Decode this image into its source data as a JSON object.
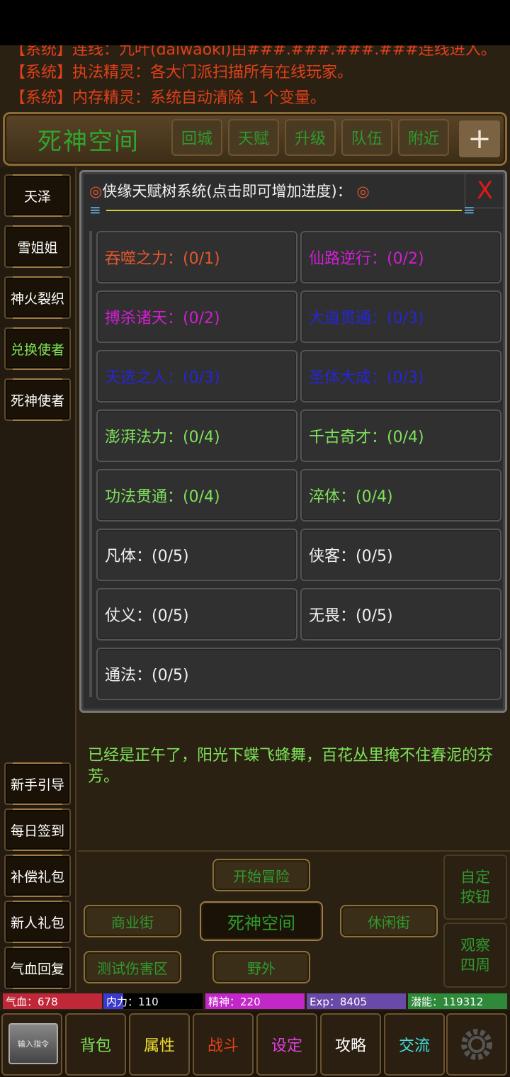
{
  "system_messages": [
    "【系统】连线：九叶(daiwaoki)由###.###.###.###连线进入。",
    "【系统】执法精灵：各大门派扫描所有在线玩家。",
    "【系统】内存精灵：系统自动清除 1 个变量。"
  ],
  "location": {
    "title": "死神空间",
    "buttons": [
      "回城",
      "天赋",
      "升级",
      "队伍",
      "附近"
    ],
    "plus": "+"
  },
  "sidebar_top": [
    "天泽",
    "雪姐姐",
    "神火裂织",
    "兑换使者",
    "死神使者"
  ],
  "sidebar_top_colors": [
    "#ffffff",
    "#ffffff",
    "#ffffff",
    "#7ee25a",
    "#ffffff"
  ],
  "sidebar_bottom": [
    "新手引导",
    "每日签到",
    "补偿礼包",
    "新人礼包",
    "气血回复"
  ],
  "modal": {
    "title_prefix": "◎",
    "title": "侠缘天赋树系统(点击即可增加进度)：",
    "title_suffix": "◎",
    "close": "X",
    "talents": [
      {
        "label": "吞噬之力：(0/1)",
        "color": "#e4572e"
      },
      {
        "label": "仙路逆行：(0/2)",
        "color": "#d21ed2"
      },
      {
        "label": "搏杀诸天：(0/2)",
        "color": "#d21ed2"
      },
      {
        "label": "大道贯通：(0/3)",
        "color": "#2626d6"
      },
      {
        "label": "天选之人：(0/3)",
        "color": "#2626d6"
      },
      {
        "label": "圣体大成：(0/3)",
        "color": "#2626d6"
      },
      {
        "label": "澎湃法力：(0/4)",
        "color": "#7ee25a"
      },
      {
        "label": "千古奇才：(0/4)",
        "color": "#7ee25a"
      },
      {
        "label": "功法贯通：(0/4)",
        "color": "#7ee25a"
      },
      {
        "label": "淬体：(0/4)",
        "color": "#7ee25a"
      },
      {
        "label": "凡体：(0/5)",
        "color": "#f2f2f2"
      },
      {
        "label": "侠客：(0/5)",
        "color": "#f2f2f2"
      },
      {
        "label": "仗义：(0/5)",
        "color": "#f2f2f2"
      },
      {
        "label": "无畏：(0/5)",
        "color": "#f2f2f2"
      },
      {
        "label": "通法：(0/5)",
        "color": "#f2f2f2"
      }
    ]
  },
  "story": "已经是正午了，阳光下蝶飞蜂舞，百花丛里掩不住春泥的芬芳。",
  "nav": {
    "start": "开始冒险",
    "left": "商业街",
    "center": "死神空间",
    "right": "休闲街",
    "test": "测试伤害区",
    "wild": "野外",
    "custom": "自定\n按钮",
    "observe": "观察\n四周"
  },
  "stats": {
    "hp": "气血：678",
    "mp": "内力：110",
    "spirit": "精神：220",
    "exp": "Exp：8405",
    "potential": "潜能：119312",
    "hp_color": "#c0283a",
    "mp_color": "#3a3ad0",
    "mp_fill": 0.2,
    "spirit_color": "#c227c8",
    "exp_color": "#6a4aa8",
    "potential_color": "#2e8a3a"
  },
  "tabs": [
    {
      "label": "背包",
      "color": "#7ee25a"
    },
    {
      "label": "属性",
      "color": "#f0e030"
    },
    {
      "label": "战斗",
      "color": "#e0401a"
    },
    {
      "label": "设定",
      "color": "#e040e0"
    },
    {
      "label": "攻略",
      "color": "#ffffff"
    },
    {
      "label": "交流",
      "color": "#40e0e0"
    }
  ],
  "input_cmd": "输入指令"
}
